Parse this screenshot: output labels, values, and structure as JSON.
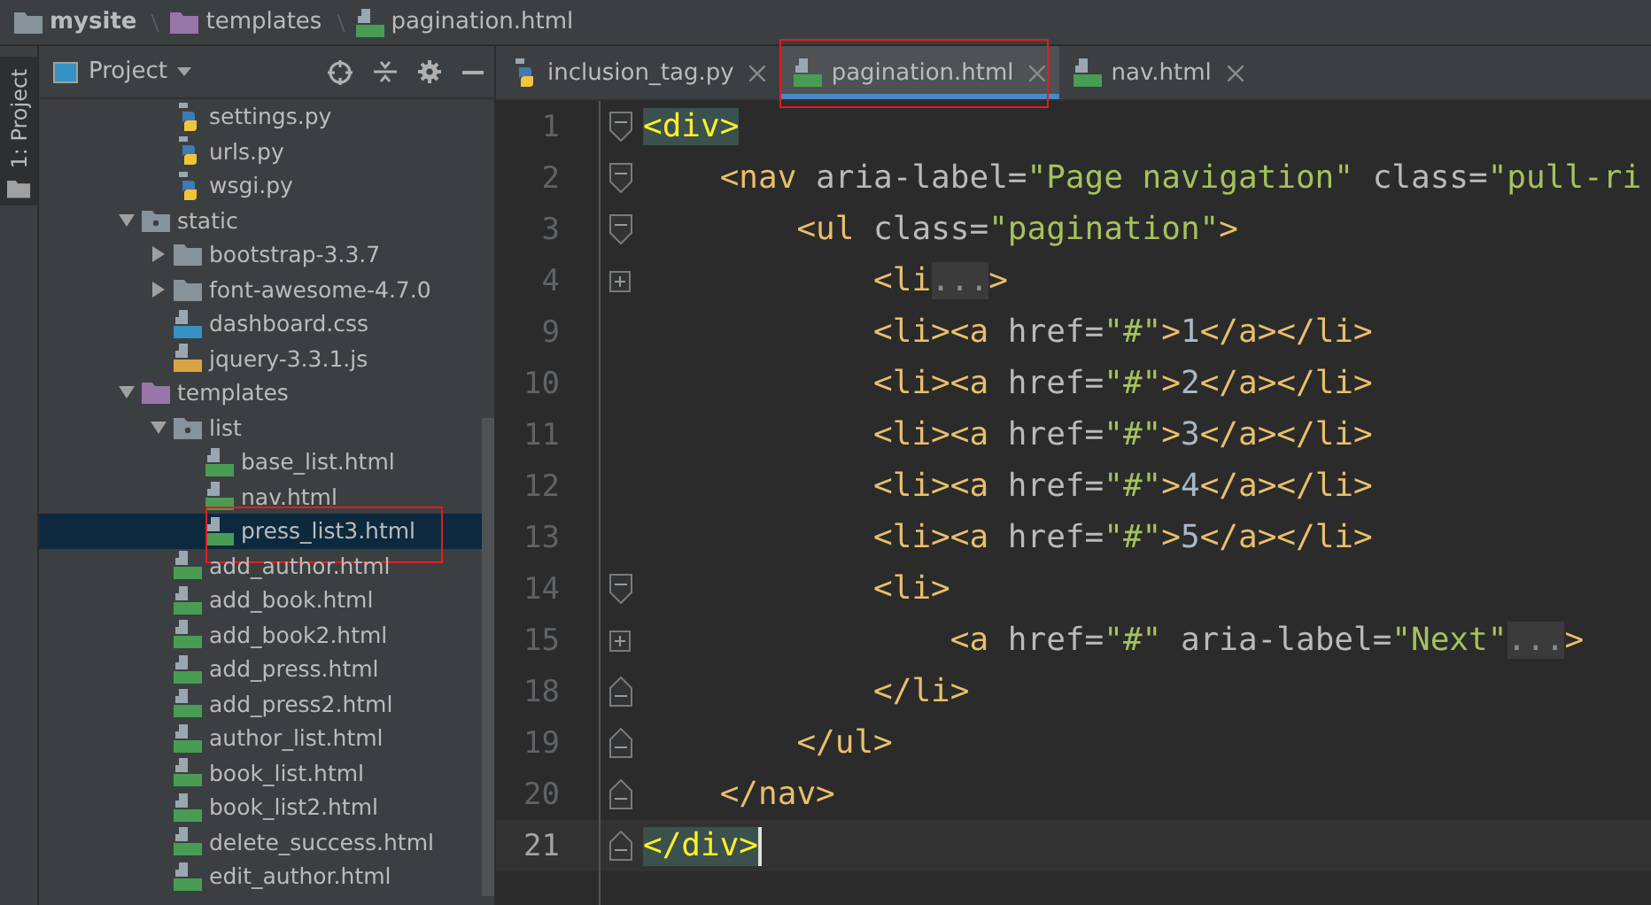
{
  "breadcrumb": [
    {
      "label": "mysite",
      "kind": "folder"
    },
    {
      "label": "templates",
      "kind": "templates-folder"
    },
    {
      "label": "pagination.html",
      "kind": "html"
    }
  ],
  "tool_strip": {
    "label": "1: Project"
  },
  "project_panel": {
    "title": "Project",
    "scrollbar": true,
    "scrolled_files": [
      {
        "label": "settings.py",
        "kind": "python",
        "selected": false,
        "annotated": false
      },
      {
        "label": "urls.py",
        "kind": "python",
        "selected": false,
        "annotated": false
      },
      {
        "label": "wsgi.py",
        "kind": "python",
        "selected": false,
        "annotated": false
      }
    ],
    "tree": [
      {
        "label": "static",
        "kind": "package",
        "expanded": true,
        "selected": false,
        "annotated": false,
        "children": [
          {
            "label": "bootstrap-3.3.7",
            "kind": "folder",
            "expanded": false,
            "selected": false,
            "annotated": false
          },
          {
            "label": "font-awesome-4.7.0",
            "kind": "folder",
            "expanded": false,
            "selected": false,
            "annotated": false
          },
          {
            "label": "dashboard.css",
            "kind": "css",
            "selected": false,
            "annotated": false
          },
          {
            "label": "jquery-3.3.1.js",
            "kind": "js",
            "selected": false,
            "annotated": false
          }
        ]
      },
      {
        "label": "templates",
        "kind": "templates-folder",
        "expanded": true,
        "selected": false,
        "annotated": false,
        "children": [
          {
            "label": "list",
            "kind": "package",
            "expanded": true,
            "selected": false,
            "annotated": false,
            "children": [
              {
                "label": "base_list.html",
                "kind": "html",
                "selected": false,
                "annotated": false
              },
              {
                "label": "nav.html",
                "kind": "html",
                "selected": false,
                "annotated": false
              },
              {
                "label": "press_list3.html",
                "kind": "html",
                "selected": true,
                "annotated": true
              }
            ]
          },
          {
            "label": "add_author.html",
            "kind": "html",
            "selected": false,
            "annotated": false
          },
          {
            "label": "add_book.html",
            "kind": "html",
            "selected": false,
            "annotated": false
          },
          {
            "label": "add_book2.html",
            "kind": "html",
            "selected": false,
            "annotated": false
          },
          {
            "label": "add_press.html",
            "kind": "html",
            "selected": false,
            "annotated": false
          },
          {
            "label": "add_press2.html",
            "kind": "html",
            "selected": false,
            "annotated": false
          },
          {
            "label": "author_list.html",
            "kind": "html",
            "selected": false,
            "annotated": false
          },
          {
            "label": "book_list.html",
            "kind": "html",
            "selected": false,
            "annotated": false
          },
          {
            "label": "book_list2.html",
            "kind": "html",
            "selected": false,
            "annotated": false
          },
          {
            "label": "delete_success.html",
            "kind": "html",
            "selected": false,
            "annotated": false
          },
          {
            "label": "edit_author.html",
            "kind": "html",
            "selected": false,
            "annotated": false
          }
        ]
      }
    ]
  },
  "tabs": [
    {
      "label": "inclusion_tag.py",
      "kind": "python",
      "selected": false,
      "annotated": false
    },
    {
      "label": "pagination.html",
      "kind": "html",
      "selected": true,
      "annotated": true
    },
    {
      "label": "nav.html",
      "kind": "html",
      "selected": false,
      "annotated": false
    }
  ],
  "code": {
    "lines": [
      {
        "number": "1",
        "kind": "open",
        "current": false,
        "tokens": [
          {
            "kind": "tag",
            "text": "<div>",
            "matched": true
          }
        ]
      },
      {
        "number": "2",
        "kind": "open",
        "current": false,
        "tokens": [
          {
            "kind": "tag",
            "text": "    <nav"
          },
          {
            "kind": "attr",
            "text": " aria-label="
          },
          {
            "kind": "value",
            "text": "\"Page navigation\""
          },
          {
            "kind": "attr",
            "text": " class="
          },
          {
            "kind": "value",
            "text": "\"pull-ri"
          }
        ]
      },
      {
        "number": "3",
        "kind": "open",
        "current": false,
        "tokens": [
          {
            "kind": "tag",
            "text": "        <ul"
          },
          {
            "kind": "attr",
            "text": " class="
          },
          {
            "kind": "value",
            "text": "\"pagination\""
          },
          {
            "kind": "tag",
            "text": ">"
          }
        ]
      },
      {
        "number": "4",
        "kind": "collapsed",
        "current": false,
        "tokens": [
          {
            "kind": "tag",
            "text": "            <li"
          },
          {
            "kind": "folded",
            "text": "..."
          },
          {
            "kind": "tag",
            "text": ">"
          }
        ]
      },
      {
        "number": "9",
        "kind": "plain",
        "current": false,
        "tokens": [
          {
            "kind": "tag",
            "text": "            <li><a"
          },
          {
            "kind": "attr",
            "text": " href="
          },
          {
            "kind": "value",
            "text": "\"#\""
          },
          {
            "kind": "tag",
            "text": ">"
          },
          {
            "kind": "text",
            "text": "1"
          },
          {
            "kind": "tag",
            "text": "</a></li>"
          }
        ]
      },
      {
        "number": "10",
        "kind": "plain",
        "current": false,
        "tokens": [
          {
            "kind": "tag",
            "text": "            <li><a"
          },
          {
            "kind": "attr",
            "text": " href="
          },
          {
            "kind": "value",
            "text": "\"#\""
          },
          {
            "kind": "tag",
            "text": ">"
          },
          {
            "kind": "text",
            "text": "2"
          },
          {
            "kind": "tag",
            "text": "</a></li>"
          }
        ]
      },
      {
        "number": "11",
        "kind": "plain",
        "current": false,
        "tokens": [
          {
            "kind": "tag",
            "text": "            <li><a"
          },
          {
            "kind": "attr",
            "text": " href="
          },
          {
            "kind": "value",
            "text": "\"#\""
          },
          {
            "kind": "tag",
            "text": ">"
          },
          {
            "kind": "text",
            "text": "3"
          },
          {
            "kind": "tag",
            "text": "</a></li>"
          }
        ]
      },
      {
        "number": "12",
        "kind": "plain",
        "current": false,
        "tokens": [
          {
            "kind": "tag",
            "text": "            <li><a"
          },
          {
            "kind": "attr",
            "text": " href="
          },
          {
            "kind": "value",
            "text": "\"#\""
          },
          {
            "kind": "tag",
            "text": ">"
          },
          {
            "kind": "text",
            "text": "4"
          },
          {
            "kind": "tag",
            "text": "</a></li>"
          }
        ]
      },
      {
        "number": "13",
        "kind": "plain",
        "current": false,
        "tokens": [
          {
            "kind": "tag",
            "text": "            <li><a"
          },
          {
            "kind": "attr",
            "text": " href="
          },
          {
            "kind": "value",
            "text": "\"#\""
          },
          {
            "kind": "tag",
            "text": ">"
          },
          {
            "kind": "text",
            "text": "5"
          },
          {
            "kind": "tag",
            "text": "</a></li>"
          }
        ]
      },
      {
        "number": "14",
        "kind": "open",
        "current": false,
        "tokens": [
          {
            "kind": "tag",
            "text": "            <li>"
          }
        ]
      },
      {
        "number": "15",
        "kind": "collapsed",
        "current": false,
        "tokens": [
          {
            "kind": "tag",
            "text": "                <a"
          },
          {
            "kind": "attr",
            "text": " href="
          },
          {
            "kind": "value",
            "text": "\"#\""
          },
          {
            "kind": "attr",
            "text": " aria-label="
          },
          {
            "kind": "value",
            "text": "\"Next\""
          },
          {
            "kind": "folded",
            "text": "..."
          },
          {
            "kind": "tag",
            "text": ">"
          }
        ]
      },
      {
        "number": "18",
        "kind": "close",
        "current": false,
        "tokens": [
          {
            "kind": "tag",
            "text": "            </li>"
          }
        ]
      },
      {
        "number": "19",
        "kind": "close",
        "current": false,
        "tokens": [
          {
            "kind": "tag",
            "text": "        </ul>"
          }
        ]
      },
      {
        "number": "20",
        "kind": "close",
        "current": false,
        "tokens": [
          {
            "kind": "tag",
            "text": "    </nav>"
          }
        ]
      },
      {
        "number": "21",
        "kind": "close",
        "current": true,
        "tokens": [
          {
            "kind": "tag",
            "text": "</div>",
            "matched": true
          }
        ]
      }
    ]
  }
}
